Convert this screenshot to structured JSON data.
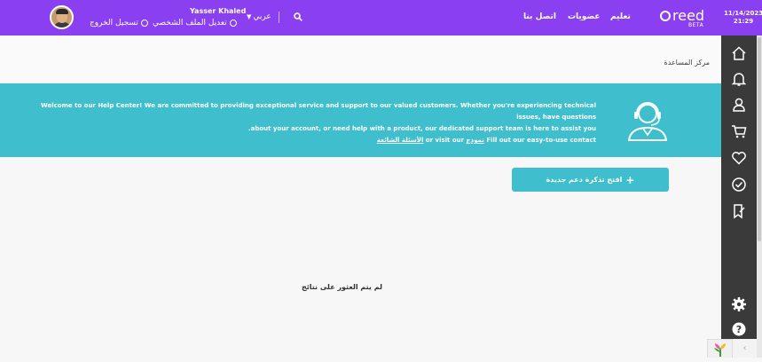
{
  "header": {
    "user_name": "Yasser Khaled",
    "edit_profile": "تعديل الملف الشخصي",
    "logout": "تسجيل الخروج",
    "language": "عربي",
    "nav": [
      "اتصل بنا",
      "عضويات",
      "تعليم"
    ],
    "logo": "reed",
    "beta": "BETA",
    "date": "11/14/2023",
    "time": "21:29"
  },
  "breadcrumb": "مركز المساعدة",
  "banner": {
    "line1": "Welcome to our Help Center! We are committed to providing exceptional service and support to our valued customers. Whether you're experiencing technical issues, have questions",
    "line2": "about your account, or need help with a product, our dedicated support team is here to assist you.",
    "line3_pre": "Fill out our easy-to-use contact",
    "form_link": "نموذج",
    "line3_mid": "or visit our",
    "faq_link": "الأسئلة الشائعة"
  },
  "new_ticket_button": "افتح تذكرة دعم جديدة",
  "empty_message": "لم يتم العثور على نتائج",
  "sidebar_icons": [
    "home-icon",
    "bell-icon",
    "user-icon",
    "cart-icon",
    "heart-icon",
    "badge-icon",
    "bookmark-icon",
    "settings-icon",
    "help-icon"
  ],
  "colors": {
    "header": "#8a3ff0",
    "accent": "#3fbfcd",
    "sidebar": "#3a3a3a"
  }
}
